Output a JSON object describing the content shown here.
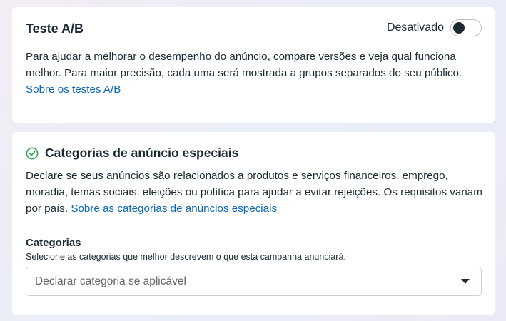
{
  "ab_test": {
    "title": "Teste A/B",
    "toggle_label": "Desativado",
    "toggle_on": false,
    "description": "Para ajudar a melhorar o desempenho do anúncio, compare versões e veja qual funciona melhor. Para maior precisão, cada uma será mostrada a grupos separados do seu público.",
    "link": "Sobre os testes A/B"
  },
  "special_categories": {
    "title": "Categorias de anúncio especiais",
    "description": "Declare se seus anúncios são relacionados a produtos e serviços financeiros, emprego, moradia, temas sociais, eleições ou política para ajudar a evitar rejeições. Os requisitos variam por país.",
    "link": "Sobre as categorias de anúncios especiais",
    "field_label": "Categorias",
    "field_help": "Selecione as categorias que melhor descrevem o que esta campanha anunciará.",
    "select_placeholder": "Declarar categoria se aplicável"
  },
  "colors": {
    "link": "#0a66b7",
    "text": "#1c2b33",
    "check": "#31a24c"
  },
  "icons": [
    "check-circle-icon",
    "chevron-down-icon"
  ]
}
